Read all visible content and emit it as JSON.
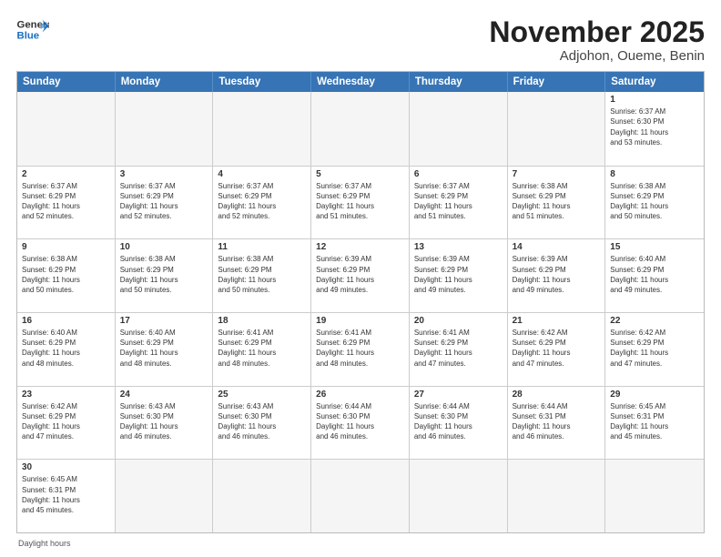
{
  "header": {
    "logo_general": "General",
    "logo_blue": "Blue",
    "title": "November 2025",
    "subtitle": "Adjohon, Oueme, Benin"
  },
  "weekdays": [
    "Sunday",
    "Monday",
    "Tuesday",
    "Wednesday",
    "Thursday",
    "Friday",
    "Saturday"
  ],
  "footer": "Daylight hours",
  "weeks": [
    [
      {
        "day": "",
        "info": "",
        "empty": true
      },
      {
        "day": "",
        "info": "",
        "empty": true
      },
      {
        "day": "",
        "info": "",
        "empty": true
      },
      {
        "day": "",
        "info": "",
        "empty": true
      },
      {
        "day": "",
        "info": "",
        "empty": true
      },
      {
        "day": "",
        "info": "",
        "empty": true
      },
      {
        "day": "1",
        "info": "Sunrise: 6:37 AM\nSunset: 6:30 PM\nDaylight: 11 hours\nand 53 minutes.",
        "empty": false
      }
    ],
    [
      {
        "day": "2",
        "info": "Sunrise: 6:37 AM\nSunset: 6:29 PM\nDaylight: 11 hours\nand 52 minutes.",
        "empty": false
      },
      {
        "day": "3",
        "info": "Sunrise: 6:37 AM\nSunset: 6:29 PM\nDaylight: 11 hours\nand 52 minutes.",
        "empty": false
      },
      {
        "day": "4",
        "info": "Sunrise: 6:37 AM\nSunset: 6:29 PM\nDaylight: 11 hours\nand 52 minutes.",
        "empty": false
      },
      {
        "day": "5",
        "info": "Sunrise: 6:37 AM\nSunset: 6:29 PM\nDaylight: 11 hours\nand 51 minutes.",
        "empty": false
      },
      {
        "day": "6",
        "info": "Sunrise: 6:37 AM\nSunset: 6:29 PM\nDaylight: 11 hours\nand 51 minutes.",
        "empty": false
      },
      {
        "day": "7",
        "info": "Sunrise: 6:38 AM\nSunset: 6:29 PM\nDaylight: 11 hours\nand 51 minutes.",
        "empty": false
      },
      {
        "day": "8",
        "info": "Sunrise: 6:38 AM\nSunset: 6:29 PM\nDaylight: 11 hours\nand 50 minutes.",
        "empty": false
      }
    ],
    [
      {
        "day": "9",
        "info": "Sunrise: 6:38 AM\nSunset: 6:29 PM\nDaylight: 11 hours\nand 50 minutes.",
        "empty": false
      },
      {
        "day": "10",
        "info": "Sunrise: 6:38 AM\nSunset: 6:29 PM\nDaylight: 11 hours\nand 50 minutes.",
        "empty": false
      },
      {
        "day": "11",
        "info": "Sunrise: 6:38 AM\nSunset: 6:29 PM\nDaylight: 11 hours\nand 50 minutes.",
        "empty": false
      },
      {
        "day": "12",
        "info": "Sunrise: 6:39 AM\nSunset: 6:29 PM\nDaylight: 11 hours\nand 49 minutes.",
        "empty": false
      },
      {
        "day": "13",
        "info": "Sunrise: 6:39 AM\nSunset: 6:29 PM\nDaylight: 11 hours\nand 49 minutes.",
        "empty": false
      },
      {
        "day": "14",
        "info": "Sunrise: 6:39 AM\nSunset: 6:29 PM\nDaylight: 11 hours\nand 49 minutes.",
        "empty": false
      },
      {
        "day": "15",
        "info": "Sunrise: 6:40 AM\nSunset: 6:29 PM\nDaylight: 11 hours\nand 49 minutes.",
        "empty": false
      }
    ],
    [
      {
        "day": "16",
        "info": "Sunrise: 6:40 AM\nSunset: 6:29 PM\nDaylight: 11 hours\nand 48 minutes.",
        "empty": false
      },
      {
        "day": "17",
        "info": "Sunrise: 6:40 AM\nSunset: 6:29 PM\nDaylight: 11 hours\nand 48 minutes.",
        "empty": false
      },
      {
        "day": "18",
        "info": "Sunrise: 6:41 AM\nSunset: 6:29 PM\nDaylight: 11 hours\nand 48 minutes.",
        "empty": false
      },
      {
        "day": "19",
        "info": "Sunrise: 6:41 AM\nSunset: 6:29 PM\nDaylight: 11 hours\nand 48 minutes.",
        "empty": false
      },
      {
        "day": "20",
        "info": "Sunrise: 6:41 AM\nSunset: 6:29 PM\nDaylight: 11 hours\nand 47 minutes.",
        "empty": false
      },
      {
        "day": "21",
        "info": "Sunrise: 6:42 AM\nSunset: 6:29 PM\nDaylight: 11 hours\nand 47 minutes.",
        "empty": false
      },
      {
        "day": "22",
        "info": "Sunrise: 6:42 AM\nSunset: 6:29 PM\nDaylight: 11 hours\nand 47 minutes.",
        "empty": false
      }
    ],
    [
      {
        "day": "23",
        "info": "Sunrise: 6:42 AM\nSunset: 6:29 PM\nDaylight: 11 hours\nand 47 minutes.",
        "empty": false
      },
      {
        "day": "24",
        "info": "Sunrise: 6:43 AM\nSunset: 6:30 PM\nDaylight: 11 hours\nand 46 minutes.",
        "empty": false
      },
      {
        "day": "25",
        "info": "Sunrise: 6:43 AM\nSunset: 6:30 PM\nDaylight: 11 hours\nand 46 minutes.",
        "empty": false
      },
      {
        "day": "26",
        "info": "Sunrise: 6:44 AM\nSunset: 6:30 PM\nDaylight: 11 hours\nand 46 minutes.",
        "empty": false
      },
      {
        "day": "27",
        "info": "Sunrise: 6:44 AM\nSunset: 6:30 PM\nDaylight: 11 hours\nand 46 minutes.",
        "empty": false
      },
      {
        "day": "28",
        "info": "Sunrise: 6:44 AM\nSunset: 6:31 PM\nDaylight: 11 hours\nand 46 minutes.",
        "empty": false
      },
      {
        "day": "29",
        "info": "Sunrise: 6:45 AM\nSunset: 6:31 PM\nDaylight: 11 hours\nand 45 minutes.",
        "empty": false
      }
    ],
    [
      {
        "day": "30",
        "info": "Sunrise: 6:45 AM\nSunset: 6:31 PM\nDaylight: 11 hours\nand 45 minutes.",
        "empty": false
      },
      {
        "day": "",
        "info": "",
        "empty": true
      },
      {
        "day": "",
        "info": "",
        "empty": true
      },
      {
        "day": "",
        "info": "",
        "empty": true
      },
      {
        "day": "",
        "info": "",
        "empty": true
      },
      {
        "day": "",
        "info": "",
        "empty": true
      },
      {
        "day": "",
        "info": "",
        "empty": true
      }
    ]
  ]
}
